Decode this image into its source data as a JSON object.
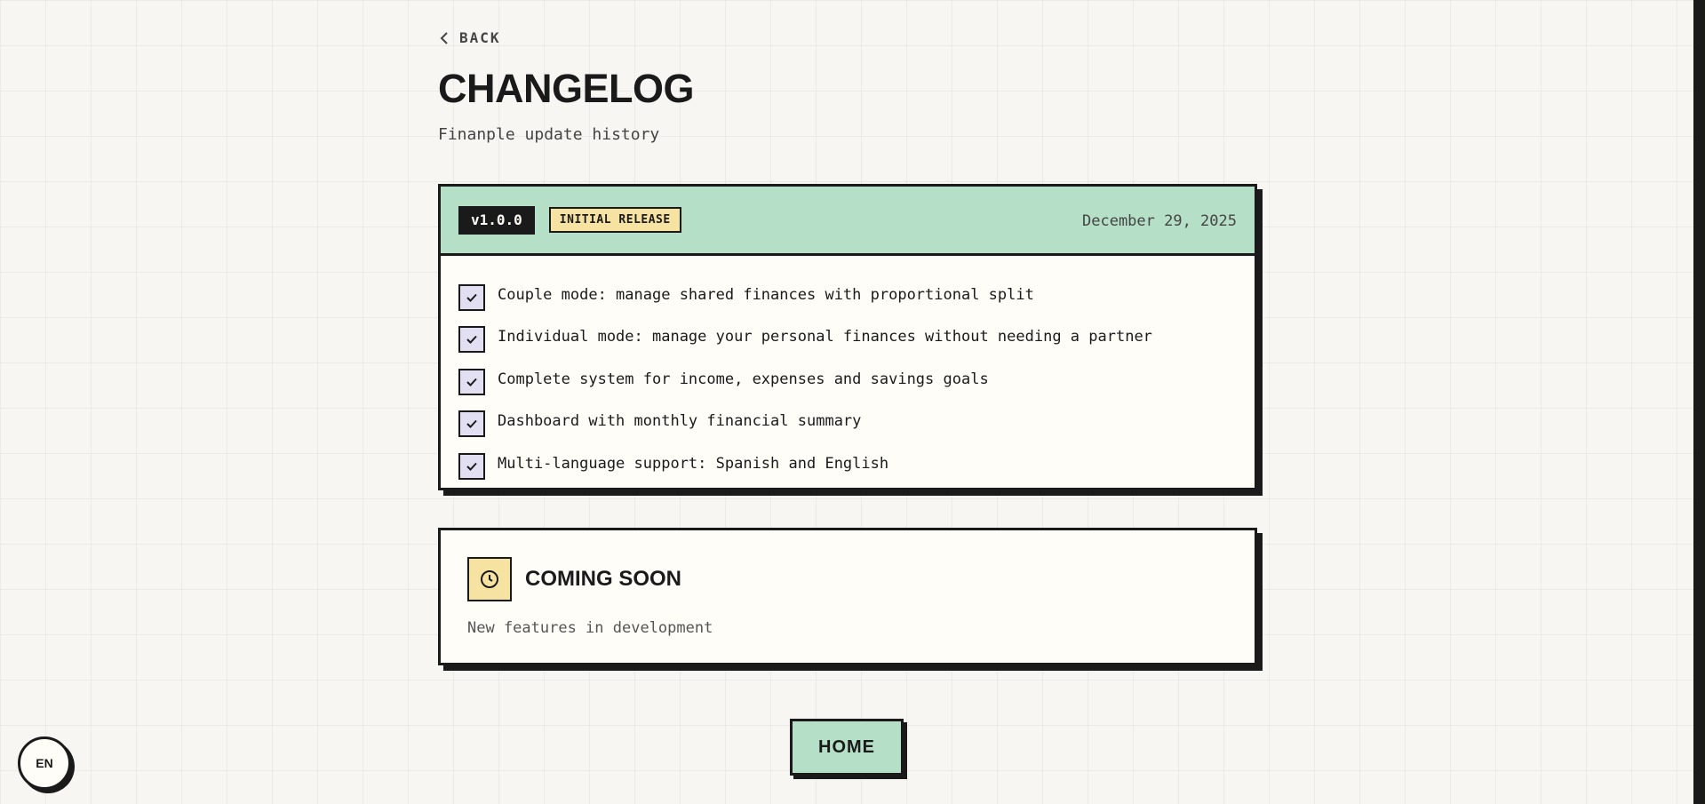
{
  "nav": {
    "back_label": "BACK",
    "back_icon": "chevron-left-icon"
  },
  "header": {
    "title": "CHANGELOG",
    "subtitle": "Finanple update history"
  },
  "release": {
    "version": "v1.0.0",
    "tag": "INITIAL RELEASE",
    "date": "December 29, 2025",
    "features": [
      "Couple mode: manage shared finances with proportional split",
      "Individual mode: manage your personal finances without needing a partner",
      "Complete system for income, expenses and savings goals",
      "Dashboard with monthly financial summary",
      "Multi-language support: Spanish and English"
    ]
  },
  "coming_soon": {
    "icon": "clock-icon",
    "title": "COMING SOON",
    "description": "New features in development"
  },
  "home_button": {
    "label": "HOME"
  },
  "language_toggle": {
    "label": "EN"
  },
  "colors": {
    "background": "#f8f6f2",
    "ink": "#1a1a1a",
    "mint": "#b6dfc8",
    "butter": "#f7e3a1",
    "lavender": "#e2dff2",
    "card": "#fffdf8"
  }
}
